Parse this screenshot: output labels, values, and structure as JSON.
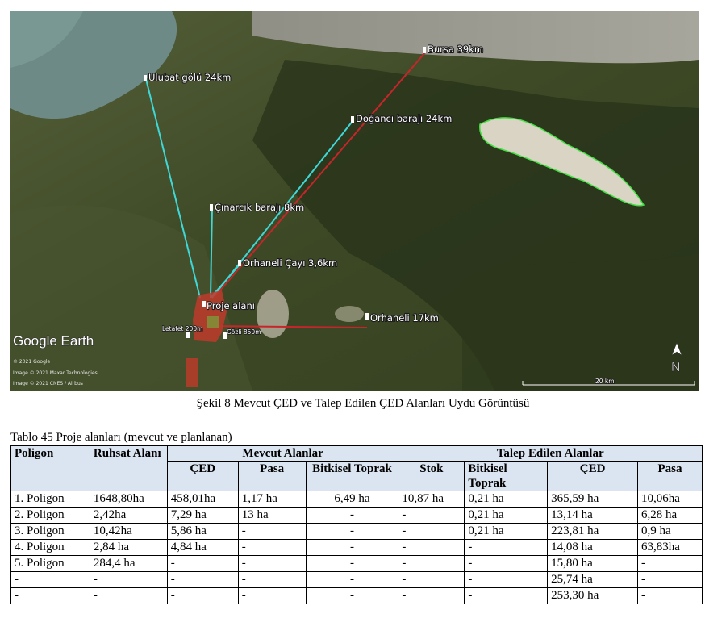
{
  "figure": {
    "labels": {
      "bursa": "Bursa 39km",
      "ulubat": "Ulubat gölü 24km",
      "dogancı": "Doğancı barajı 24km",
      "cinarcik": "Çınarcık barajı 8km",
      "orhaneli_cayi": "Orhaneli Çayı 3,6km",
      "proje": "Proje alanı",
      "orhaneli": "Orhaneli 17km",
      "letafet": "Letafet 200m",
      "gozli": "Gözli 850m"
    },
    "google_earth": "Google Earth",
    "credits": [
      "© 2021 Google",
      "Image © 2021 Maxar Technologies",
      "Image © 2021 CNES / Airbus"
    ],
    "north": "N",
    "scale": "20 km",
    "colors": {
      "cyan_line": "#3fd8d8",
      "red_line": "#c8252b",
      "green_outline": "#40e040",
      "project_fill": "#c0392b"
    }
  },
  "caption": "Şekil 8 Mevcut ÇED ve Talep Edilen ÇED Alanları Uydu Görüntüsü",
  "table": {
    "title": "Tablo 45 Proje alanları (mevcut ve planlanan)",
    "header": {
      "poligon": "Poligon",
      "ruhsat": "Ruhsat Alanı",
      "mevcut": "Mevcut Alanlar",
      "talep": "Talep Edilen Alanlar",
      "sub": [
        "ÇED",
        "Pasa",
        "Bitkisel Toprak",
        "Stok",
        "Bitkisel Toprak",
        "ÇED",
        "Pasa"
      ]
    },
    "rows": [
      [
        "1. Poligon",
        "1648,80ha",
        "458,01ha",
        "1,17 ha",
        "6,49 ha",
        "10,87 ha",
        "0,21 ha",
        "365,59 ha",
        "10,06ha"
      ],
      [
        "2. Poligon",
        "2,42ha",
        "7,29 ha",
        "13 ha",
        "-",
        "-",
        "0,21 ha",
        "13,14 ha",
        "6,28 ha"
      ],
      [
        "3. Poligon",
        "10,42ha",
        "5,86 ha",
        "-",
        "-",
        "-",
        "0,21 ha",
        "223,81 ha",
        "0,9 ha"
      ],
      [
        "4. Poligon",
        "2,84 ha",
        "4,84 ha",
        "-",
        "-",
        "-",
        "-",
        "14,08 ha",
        "63,83ha"
      ],
      [
        "5. Poligon",
        "284,4 ha",
        "-",
        "-",
        "-",
        "-",
        "-",
        "15,80 ha",
        "-"
      ],
      [
        "-",
        "-",
        "-",
        "-",
        "-",
        "-",
        "-",
        "25,74 ha",
        "-"
      ],
      [
        "-",
        "-",
        "-",
        "-",
        "-",
        "-",
        "-",
        "253,30 ha",
        "-"
      ]
    ]
  }
}
